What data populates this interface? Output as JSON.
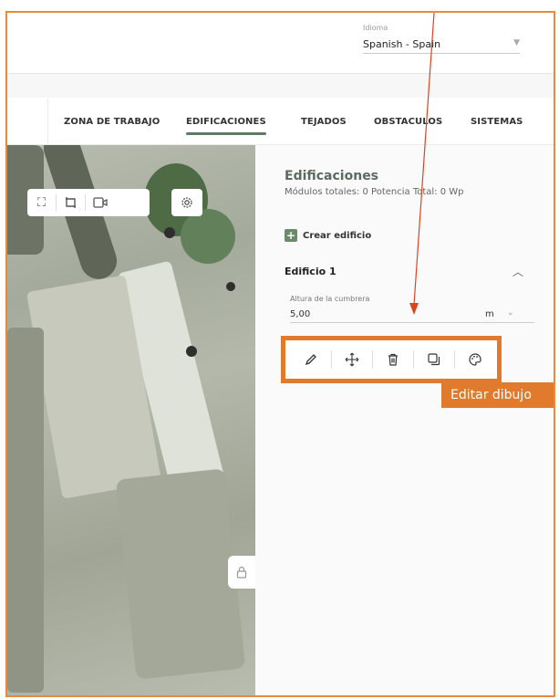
{
  "header": {
    "language_label": "Idioma",
    "language_value": "Spanish - Spain"
  },
  "nav": {
    "items": [
      {
        "label": "ZONA DE TRABAJO",
        "active": false
      },
      {
        "label": "EDIFICACIONES",
        "active": true
      },
      {
        "label": "TEJADOS",
        "active": false
      },
      {
        "label": "OBSTACULOS",
        "active": false
      },
      {
        "label": "SISTEMAS",
        "active": false
      }
    ]
  },
  "map": {
    "toolbar_icons": [
      "fullscreen-icon",
      "crop-icon",
      "camera-icon"
    ],
    "settings_icon": "gear-icon",
    "lock_icon": "lock-icon"
  },
  "panel": {
    "title": "Edificaciones",
    "subtitle": "Módulos totales: 0 Potencia Total: 0 Wp",
    "create_label": "Crear edificio",
    "building": {
      "name": "Edificio 1",
      "ridge_label": "Altura de la cumbrera",
      "ridge_value": "5,00",
      "ridge_unit": "m"
    },
    "tools": [
      "pencil-icon",
      "move-icon",
      "trash-icon",
      "duplicate-icon",
      "palette-icon"
    ],
    "tooltip": "Editar dibujo"
  },
  "colors": {
    "annotation": "#e07b2e",
    "accent": "#5f7a63"
  }
}
